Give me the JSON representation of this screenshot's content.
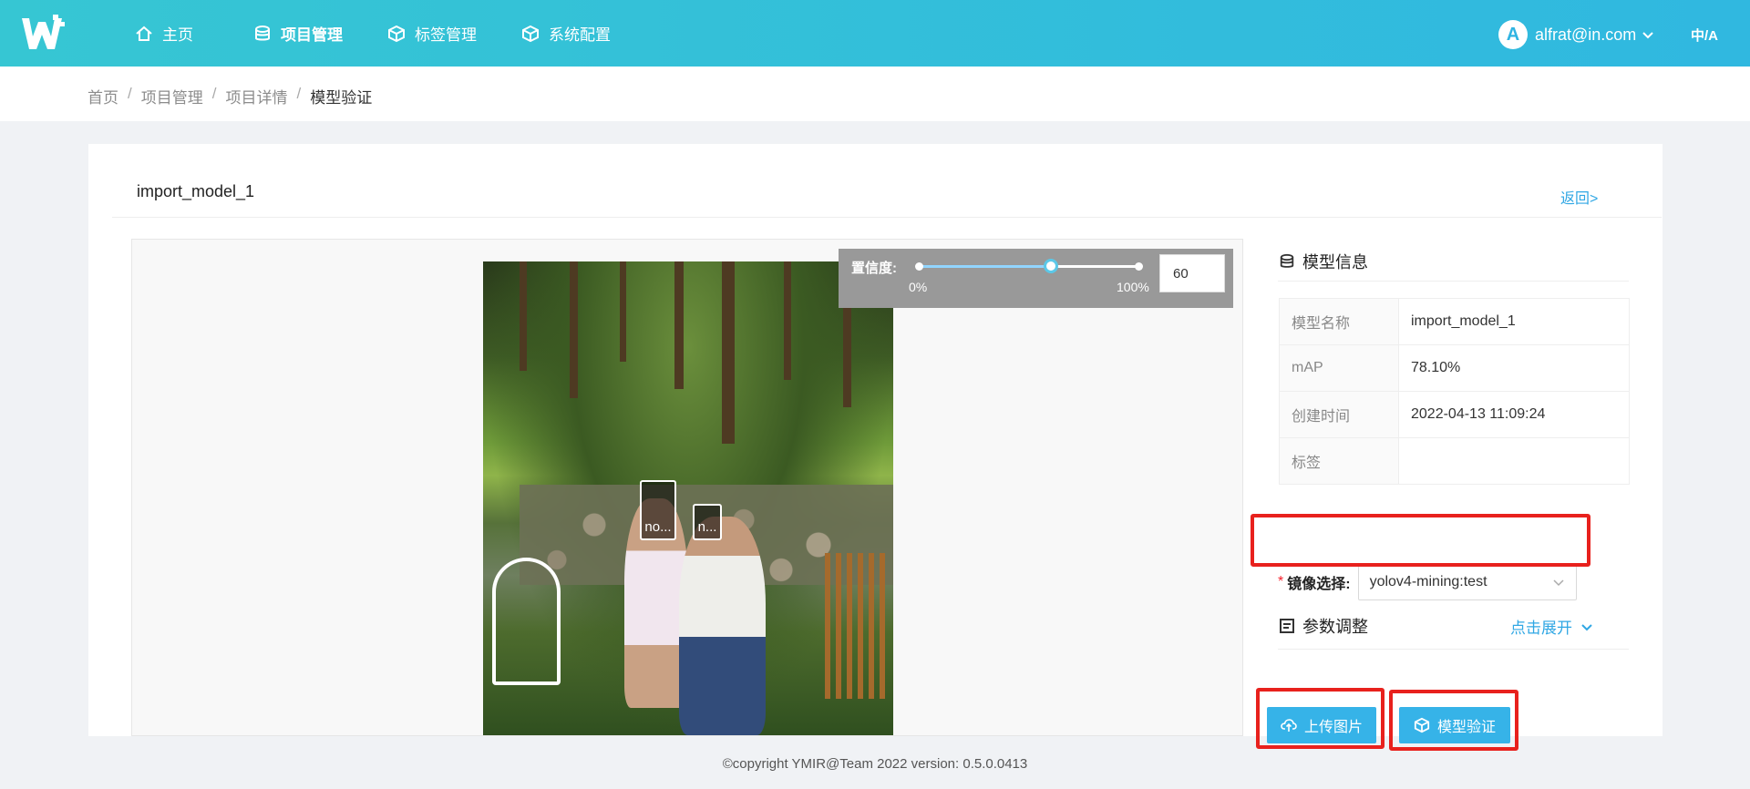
{
  "header": {
    "nav": [
      {
        "label": "主页",
        "icon": "home-icon"
      },
      {
        "label": "项目管理",
        "icon": "database-icon",
        "active": true
      },
      {
        "label": "标签管理",
        "icon": "cube-icon"
      },
      {
        "label": "系统配置",
        "icon": "cube-icon"
      }
    ],
    "user": {
      "avatar_letter": "A",
      "email": "alfrat@in.com"
    },
    "lang_icon": "translate-icon",
    "brand_color": "#30b8e0"
  },
  "breadcrumb": [
    {
      "label": "首页"
    },
    {
      "label": "项目管理"
    },
    {
      "label": "项目详情"
    },
    {
      "label": "模型验证",
      "current": true
    }
  ],
  "card": {
    "title": "import_model_1",
    "back_label": "返回>"
  },
  "viewer": {
    "confidence_label": "置信度:",
    "min_label": "0%",
    "max_label": "100%",
    "confidence_value": "60",
    "confidence_fraction": 0.6,
    "detections": [
      {
        "label": "no..."
      },
      {
        "label": "n..."
      }
    ]
  },
  "model_info": {
    "title": "模型信息",
    "rows": [
      {
        "key": "模型名称",
        "value": "import_model_1"
      },
      {
        "key": "mAP",
        "value": "78.10%"
      },
      {
        "key": "创建时间",
        "value": "2022-04-13 11:09:24"
      },
      {
        "key": "标签",
        "value": ""
      }
    ]
  },
  "image_select": {
    "required_mark": "*",
    "label": "镜像选择:",
    "value": "yolov4-mining:test"
  },
  "params": {
    "title": "参数调整",
    "expand_label": "点击展开"
  },
  "actions": {
    "upload_label": "上传图片",
    "verify_label": "模型验证"
  },
  "footer": {
    "text": "©copyright YMIR@Team 2022 version: 0.5.0.0413"
  }
}
